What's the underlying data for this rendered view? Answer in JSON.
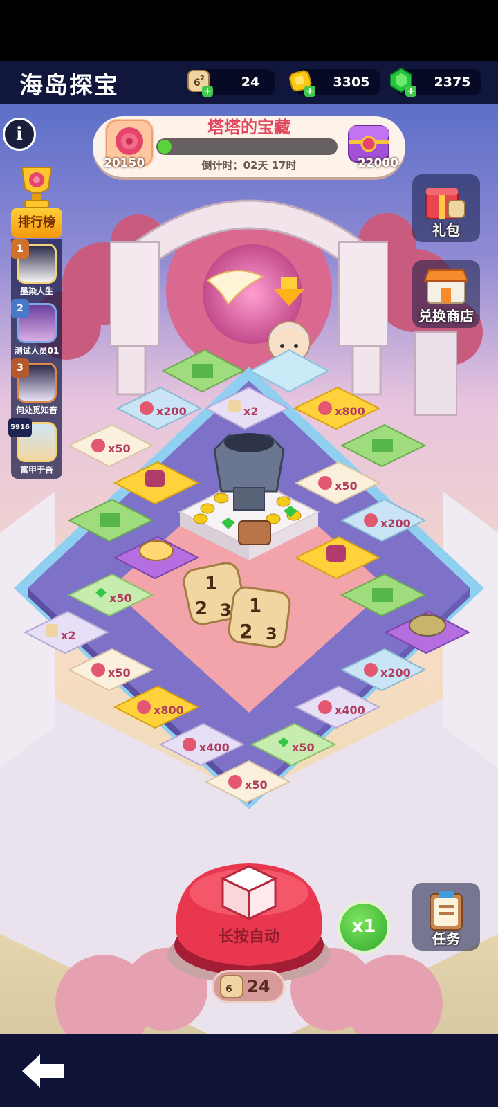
{
  "header": {
    "title": "海岛探宝",
    "dice_count": "24",
    "coins": "3305",
    "gems": "2375"
  },
  "event": {
    "title": "塔塔的宝藏",
    "current_points": "20150",
    "target_points": "22000",
    "countdown": "倒计时：02天 17时",
    "progress_fraction": 0.02
  },
  "leaderboard": {
    "label": "排行榜",
    "entries": [
      {
        "rank": "1",
        "name": "墨染人生"
      },
      {
        "rank": "2",
        "name": "测试人员01"
      },
      {
        "rank": "3",
        "name": "何处觅知音"
      },
      {
        "rank": "5916",
        "name": "富甲于吾"
      }
    ]
  },
  "side_buttons": {
    "gift_label": "礼包",
    "shop_label": "兑换商店",
    "task_label": "任务"
  },
  "board": {
    "tiles": {
      "t01": "x\n200",
      "t02": "x\n2",
      "t03": "x\n800",
      "t04": "x\n50",
      "t05": "x\n50",
      "t06": "x\n200",
      "t07": "x\n50",
      "t08": "x\n2",
      "t09": "x\n50",
      "t10": "x\n800",
      "t11": "x\n400",
      "t12": "x\n50",
      "t13": "x\n200",
      "t14": "x\n400",
      "t15": "x\n50"
    },
    "dice_faces": [
      "1",
      "2",
      "3"
    ]
  },
  "controls": {
    "roll_label": "长按自动",
    "multiplier": "x1",
    "dice_remaining": "24"
  },
  "colors": {
    "roll_button": "#e8374f",
    "multiplier_button": "#3fbe37",
    "top_bar": "#10163c"
  }
}
